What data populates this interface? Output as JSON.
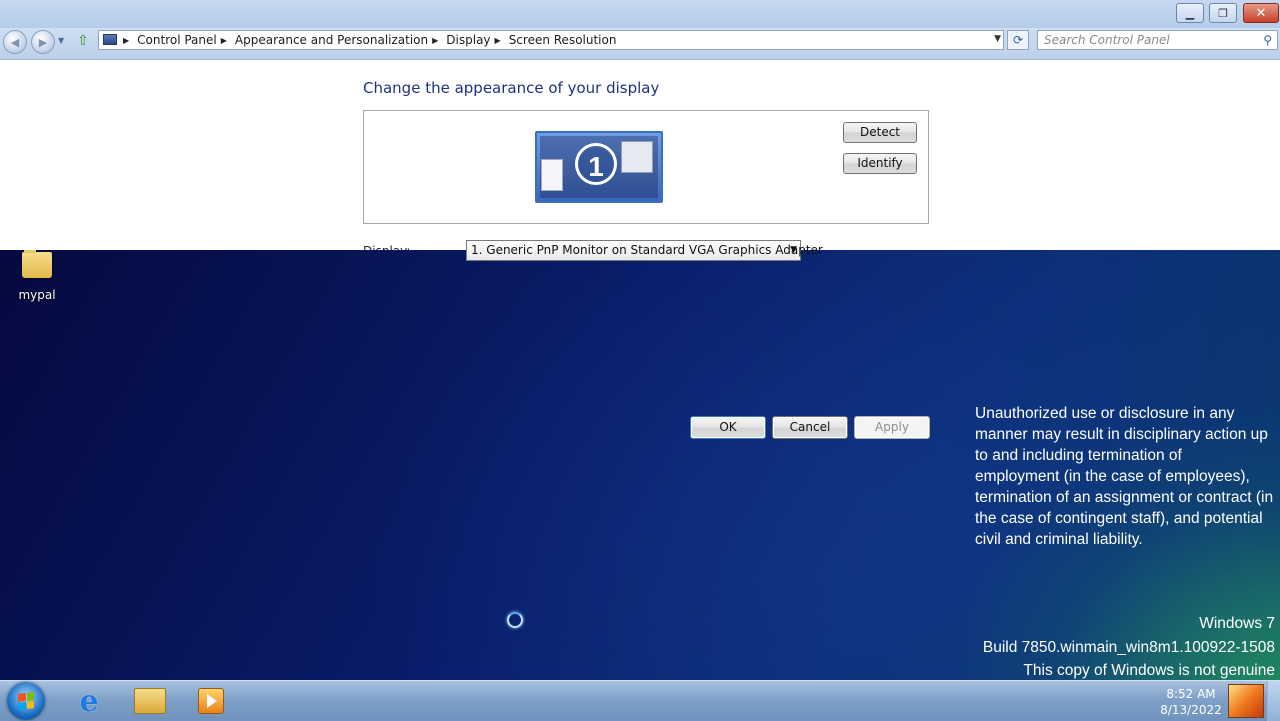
{
  "window": {
    "title_buttons": {
      "minimize": "minimize-icon",
      "maximize": "restore-icon",
      "close": "close-icon"
    },
    "breadcrumb": [
      "Control Panel",
      "Appearance and Personalization",
      "Display",
      "Screen Resolution"
    ],
    "search_placeholder": "Search Control Panel",
    "heading": "Change the appearance of your display",
    "monitor_number": "1",
    "detect_label": "Detect",
    "identify_label": "Identify",
    "display_label": "Display:",
    "display_select_value": "1. Generic PnP Monitor on Standard VGA Graphics Adapter",
    "ok_label": "OK",
    "cancel_label": "Cancel",
    "apply_label": "Apply"
  },
  "desktop": {
    "icon_label": "mypal",
    "warning_lines": [
      "Unauthorized use or disclosure in any",
      "manner may result in disciplinary action up",
      "to and including termination of",
      "employment (in the case of employees),",
      "termination of an assignment or contract (in",
      "the case of contingent staff), and potential",
      "civil and criminal liability."
    ],
    "watermark": {
      "line1": "Windows 7",
      "line2": "Build 7850.winmain_win8m1.100922-1508",
      "line3": "This copy of Windows is not genuine"
    }
  },
  "taskbar": {
    "time": "8:52 AM",
    "date": "8/13/2022",
    "pinned": [
      "internet-explorer-icon",
      "windows-explorer-icon",
      "media-player-icon"
    ]
  },
  "colors": {
    "heading": "#1e3287",
    "taskbar": "#7fa1c8",
    "desktop": "#08155a"
  }
}
